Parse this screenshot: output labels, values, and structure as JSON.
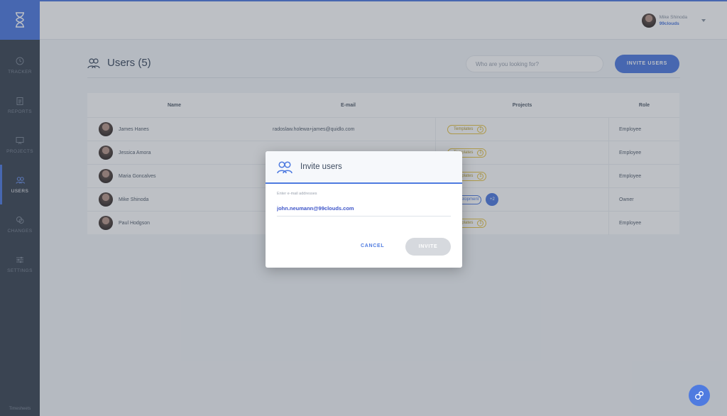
{
  "sidebar": {
    "items": [
      {
        "label": "TRACKER",
        "icon": "clock-icon"
      },
      {
        "label": "REPORTS",
        "icon": "clipboard-icon"
      },
      {
        "label": "PROJECTS",
        "icon": "presentation-icon"
      },
      {
        "label": "USERS",
        "icon": "users-icon",
        "active": true
      },
      {
        "label": "CHANGES",
        "icon": "chat-icon"
      },
      {
        "label": "SETTINGS",
        "icon": "sliders-icon"
      }
    ],
    "footer": "Timesheets"
  },
  "topbar": {
    "user_name": "Mike Shinoda",
    "org": "99clouds"
  },
  "page": {
    "title": "Users (5)",
    "search_placeholder": "Who are you looking for?",
    "invite_button": "INVITE USERS"
  },
  "table": {
    "headers": [
      "Name",
      "E-mail",
      "Projects",
      "Role"
    ],
    "rows": [
      {
        "name": "James Hanes",
        "email": "radoslaw.holewa+james@quidlo.com",
        "project": "Templates",
        "count": "1",
        "role": "Employee"
      },
      {
        "name": "Jessica Amora",
        "email": "",
        "project": "Templates",
        "count": "1",
        "role": "Employee"
      },
      {
        "name": "Maria Goncalves",
        "email": "",
        "project": "Templates",
        "count": "1",
        "role": "Employee"
      },
      {
        "name": "Mike Shinoda",
        "email": "",
        "project": "Development",
        "count": "",
        "more": "+2",
        "role": "Owner"
      },
      {
        "name": "Paul Hodgson",
        "email": "",
        "project": "Templates",
        "count": "1",
        "role": "Employee"
      }
    ]
  },
  "modal": {
    "title": "Invite users",
    "field_label": "Enter e-mail addresses",
    "field_value": "john.neumann@99clouds.com",
    "cancel": "CANCEL",
    "invite": "INVITE"
  },
  "colors": {
    "accent": "#4f7be0",
    "sidebar": "#3c4654",
    "pill": "#e8c547"
  }
}
